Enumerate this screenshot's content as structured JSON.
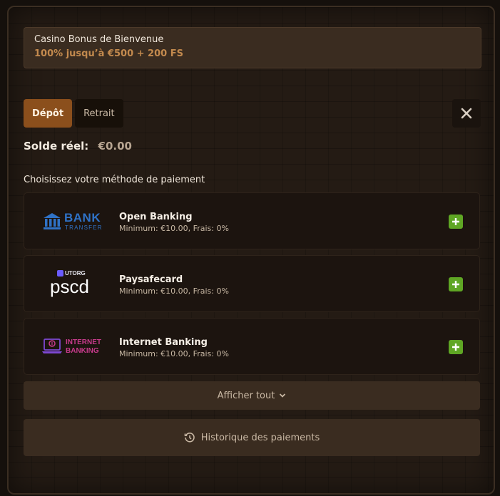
{
  "bonus": {
    "title": "Casino Bonus de Bienvenue",
    "offer": "100% jusqu’à €500 + 200 FS"
  },
  "tabs": [
    {
      "label": "Dépôt",
      "active": true
    },
    {
      "label": "Retrait",
      "active": false
    }
  ],
  "balance": {
    "label": "Solde réel:",
    "value": "€0.00"
  },
  "choose_label": "Choisissez votre méthode de paiement",
  "methods": [
    {
      "name": "Open Banking",
      "desc": "Minimum: €10.00, Frais: 0%",
      "logo": {
        "line1": "BANK",
        "line2": "TRANSFER"
      }
    },
    {
      "name": "Paysafecard",
      "desc": "Minimum: €10.00, Frais: 0%",
      "logo": {
        "badge": "UTORG",
        "text": "pscd"
      }
    },
    {
      "name": "Internet Banking",
      "desc": "Minimum: €10.00, Frais: 0%",
      "logo": {
        "line1": "INTERNET",
        "line2": "BANKING"
      }
    }
  ],
  "show_all_label": "Afficher tout",
  "history_label": "Historique des paiements",
  "colors": {
    "accent": "#8b4f1c",
    "bonus_text": "#c38a4e",
    "plus_green": "#5fa624",
    "bank_blue": "#2f72c6",
    "internet_pink": "#c73b8c",
    "internet_purple": "#7d48d2"
  },
  "icons": {
    "close": "close-icon",
    "plus": "plus-icon",
    "chevron": "chevron-down-icon",
    "history": "history-icon",
    "bank": "bank-building-icon",
    "laptop": "laptop-dollar-icon"
  }
}
